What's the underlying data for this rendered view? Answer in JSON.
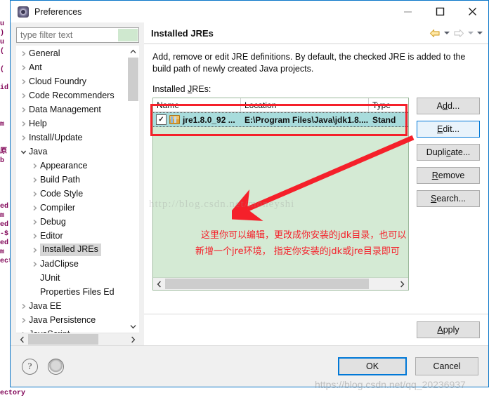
{
  "window": {
    "title": "Preferences",
    "icon": "preferences-icon",
    "minimize_label": "─",
    "maximize_label": "□",
    "close_label": "✕"
  },
  "filter": {
    "placeholder": "type filter text",
    "value": ""
  },
  "tree": {
    "items": [
      {
        "label": "General",
        "level": 1,
        "expandable": true,
        "expanded": false,
        "selected": false
      },
      {
        "label": "Ant",
        "level": 1,
        "expandable": true,
        "expanded": false,
        "selected": false
      },
      {
        "label": "Cloud Foundry",
        "level": 1,
        "expandable": true,
        "expanded": false,
        "selected": false
      },
      {
        "label": "Code Recommenders",
        "level": 1,
        "expandable": true,
        "expanded": false,
        "selected": false
      },
      {
        "label": "Data Management",
        "level": 1,
        "expandable": true,
        "expanded": false,
        "selected": false
      },
      {
        "label": "Help",
        "level": 1,
        "expandable": true,
        "expanded": false,
        "selected": false
      },
      {
        "label": "Install/Update",
        "level": 1,
        "expandable": true,
        "expanded": false,
        "selected": false
      },
      {
        "label": "Java",
        "level": 1,
        "expandable": true,
        "expanded": true,
        "selected": false
      },
      {
        "label": "Appearance",
        "level": 2,
        "expandable": true,
        "expanded": false,
        "selected": false
      },
      {
        "label": "Build Path",
        "level": 2,
        "expandable": true,
        "expanded": false,
        "selected": false
      },
      {
        "label": "Code Style",
        "level": 2,
        "expandable": true,
        "expanded": false,
        "selected": false
      },
      {
        "label": "Compiler",
        "level": 2,
        "expandable": true,
        "expanded": false,
        "selected": false
      },
      {
        "label": "Debug",
        "level": 2,
        "expandable": true,
        "expanded": false,
        "selected": false
      },
      {
        "label": "Editor",
        "level": 2,
        "expandable": true,
        "expanded": false,
        "selected": false
      },
      {
        "label": "Installed JREs",
        "level": 2,
        "expandable": true,
        "expanded": false,
        "selected": true
      },
      {
        "label": "JadClipse",
        "level": 2,
        "expandable": true,
        "expanded": false,
        "selected": false
      },
      {
        "label": "JUnit",
        "level": 2,
        "expandable": false,
        "expanded": false,
        "selected": false
      },
      {
        "label": "Properties Files Ed",
        "level": 2,
        "expandable": false,
        "expanded": false,
        "selected": false
      },
      {
        "label": "Java EE",
        "level": 1,
        "expandable": true,
        "expanded": false,
        "selected": false
      },
      {
        "label": "Java Persistence",
        "level": 1,
        "expandable": true,
        "expanded": false,
        "selected": false
      },
      {
        "label": "JavaScript",
        "level": 1,
        "expandable": true,
        "expanded": false,
        "selected": false
      }
    ],
    "scroll_up_icon": "chevron-up-icon",
    "scroll_down_icon": "chevron-down-icon",
    "scroll_left_icon": "chevron-left-icon",
    "scroll_right_icon": "chevron-right-icon"
  },
  "panel": {
    "title": "Installed JREs",
    "description": "Add, remove or edit JRE definitions. By default, the checked JRE is added to the build path of newly created Java projects.",
    "list_label_prefix": "Installed ",
    "list_label_underlined": "J",
    "list_label_suffix": "REs:",
    "nav": {
      "back_icon": "arrow-left-icon",
      "back_caret_icon": "caret-down-icon",
      "forward_icon": "arrow-right-icon",
      "forward_caret_icon": "caret-down-icon",
      "menu_caret_icon": "caret-down-icon"
    }
  },
  "table": {
    "columns": [
      "Name",
      "Location",
      "Type"
    ],
    "rows": [
      {
        "checked": true,
        "icon": "jre-icon",
        "name": "jre1.8.0_92 ...",
        "location": "E:\\Program Files\\Java\\jdk1.8....",
        "type": "Stand",
        "selected": true
      }
    ],
    "hscroll_left_icon": "chevron-left-icon",
    "hscroll_right_icon": "chevron-right-icon"
  },
  "buttons": {
    "add": {
      "pre": "A",
      "mnemonic": "d",
      "post": "d..."
    },
    "edit": {
      "pre": "",
      "mnemonic": "E",
      "post": "dit..."
    },
    "duplicate": {
      "pre": "Dupli",
      "mnemonic": "c",
      "post": "ate..."
    },
    "remove": {
      "pre": "",
      "mnemonic": "R",
      "post": "emove"
    },
    "search": {
      "pre": "",
      "mnemonic": "S",
      "post": "earch..."
    },
    "apply": {
      "pre": "",
      "mnemonic": "A",
      "post": "pply"
    },
    "ok": "OK",
    "cancel": "Cancel",
    "focused": "Edit...",
    "default": "OK"
  },
  "footer": {
    "help_icon": "question-mark-icon",
    "help_label": "?",
    "secondary_icon": "circle-icon",
    "secondary_label": ""
  },
  "annotations": {
    "line1": "这里你可以编辑，更改成你安装的jdk目录，也可以",
    "line2": "新增一个jre环境， 指定你安装的jdk或jre目录即可",
    "highlight_color": "#f5202a",
    "arrow_icon": "red-arrow-icon",
    "rect_name": "jre-table-highlight-box"
  },
  "watermarks": {
    "center": "http://blog.csdn.net/moneyshi",
    "bottom": "https://blog.csdn.net/qq_20236937"
  },
  "background": {
    "left_code": "u\n)\nu\n(\n\n(\n\nid\n\n\n\nm\n\n\n原\nb\n\n\n\n\ned\nm\ned\n-$\ned\nm\nector",
    "bottom_code": "ectory"
  }
}
